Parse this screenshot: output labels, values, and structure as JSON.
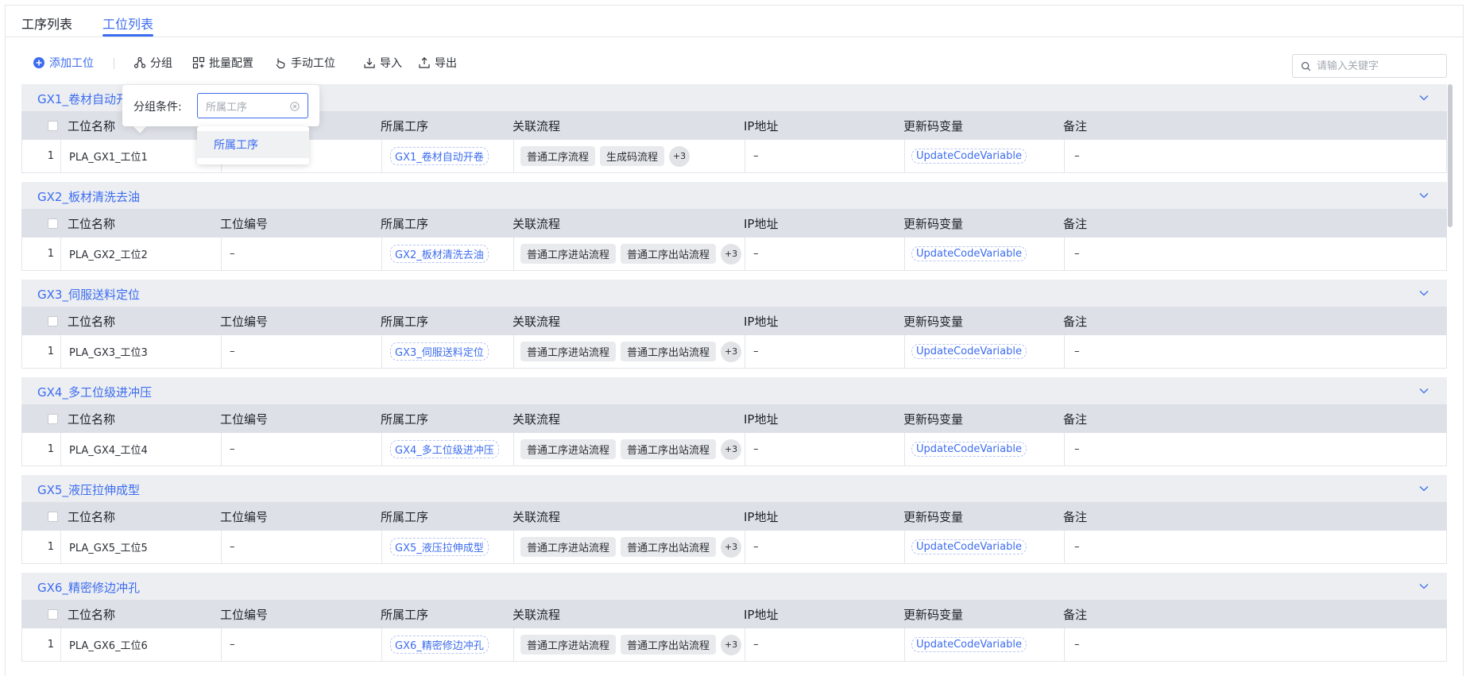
{
  "tabs": [
    {
      "label": "工序列表",
      "active": false
    },
    {
      "label": "工位列表",
      "active": true
    }
  ],
  "toolbar": {
    "add": "添加工位",
    "group": "分组",
    "batch": "批量配置",
    "manual": "手动工位",
    "import": "导入",
    "export": "导出"
  },
  "search": {
    "placeholder": "请输入关键字"
  },
  "columns": [
    "工位名称",
    "工位编号",
    "所属工序",
    "关联流程",
    "IP地址",
    "更新码变量",
    "备注"
  ],
  "groups": [
    {
      "title": "GX1_卷材自动开卷",
      "row": {
        "index": "1",
        "name": "PLA_GX1_工位1",
        "code": "",
        "process": "GX1_卷材自动开卷",
        "flows": [
          "普通工序流程",
          "生成码流程"
        ],
        "more": "+3",
        "ip": "–",
        "var": "UpdateCodeVariable",
        "remark": "–"
      }
    },
    {
      "title": "GX2_板材清洗去油",
      "row": {
        "index": "1",
        "name": "PLA_GX2_工位2",
        "code": "–",
        "process": "GX2_板材清洗去油",
        "flows": [
          "普通工序进站流程",
          "普通工序出站流程"
        ],
        "more": "+3",
        "ip": "–",
        "var": "UpdateCodeVariable",
        "remark": "–"
      }
    },
    {
      "title": "GX3_伺服送料定位",
      "row": {
        "index": "1",
        "name": "PLA_GX3_工位3",
        "code": "–",
        "process": "GX3_伺服送料定位",
        "flows": [
          "普通工序进站流程",
          "普通工序出站流程"
        ],
        "more": "+3",
        "ip": "–",
        "var": "UpdateCodeVariable",
        "remark": "–"
      }
    },
    {
      "title": "GX4_多工位级进冲压",
      "row": {
        "index": "1",
        "name": "PLA_GX4_工位4",
        "code": "–",
        "process": "GX4_多工位级进冲压",
        "flows": [
          "普通工序进站流程",
          "普通工序出站流程"
        ],
        "more": "+3",
        "ip": "–",
        "var": "UpdateCodeVariable",
        "remark": "–"
      }
    },
    {
      "title": "GX5_液压拉伸成型",
      "row": {
        "index": "1",
        "name": "PLA_GX5_工位5",
        "code": "–",
        "process": "GX5_液压拉伸成型",
        "flows": [
          "普通工序进站流程",
          "普通工序出站流程"
        ],
        "more": "+3",
        "ip": "–",
        "var": "UpdateCodeVariable",
        "remark": "–"
      }
    },
    {
      "title": "GX6_精密修边冲孔",
      "row": {
        "index": "1",
        "name": "PLA_GX6_工位6",
        "code": "–",
        "process": "GX6_精密修边冲孔",
        "flows": [
          "普通工序进站流程",
          "普通工序出站流程"
        ],
        "more": "+3",
        "ip": "–",
        "var": "UpdateCodeVariable",
        "remark": "–"
      }
    }
  ],
  "popover": {
    "label": "分组条件:",
    "placeholder": "所属工序",
    "option": "所属工序"
  },
  "colors": {
    "accent": "#3c6cf0",
    "group_header": "#eceef1",
    "table_header": "#dde0e6"
  }
}
